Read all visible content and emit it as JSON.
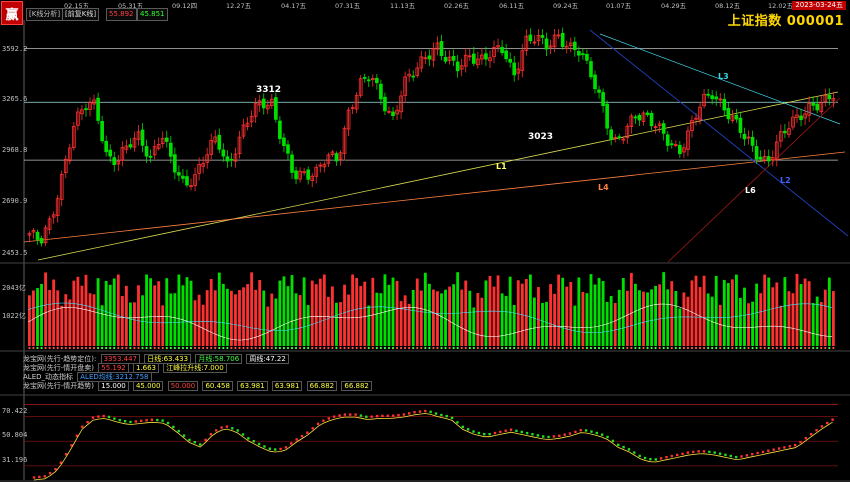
{
  "header": {
    "logo": "赢",
    "mode_label": "[K线分析]",
    "sub_label": "[前复K线]",
    "value_red": "55.892",
    "value_green": "45.851",
    "title": "上证指数  000001",
    "date_badge": "2023-03-24五"
  },
  "colors": {
    "up": "#ff3030",
    "down": "#00e000",
    "grid": "#8a1010",
    "axis": "#606060"
  },
  "chart_data": [
    {
      "type": "candlestick",
      "x_tick_labels": [
        "02.15五",
        "05.31五",
        "09.12四",
        "12.27五",
        "04.17五",
        "07.31五",
        "11.13五",
        "02.26五",
        "06.11五",
        "09.24五",
        "01.07五",
        "04.29五",
        "08.12五",
        "12.02五"
      ],
      "y_ticks": [
        "3592.2",
        "3265.6",
        "2968.8",
        "2690.9",
        "2453.5"
      ],
      "ylim": [
        2400,
        3740
      ],
      "horizontal_levels": [
        3592.2,
        3292,
        2968.8
      ],
      "annotations": [
        "3312",
        "3023",
        "L1",
        "L2",
        "L3",
        "L4",
        "L6"
      ],
      "close_path": [
        2560,
        2500,
        2640,
        2900,
        3150,
        3260,
        3290,
        3000,
        2950,
        3050,
        3120,
        2980,
        3100,
        2950,
        2850,
        2870,
        2980,
        3100,
        2950,
        3070,
        3200,
        3300,
        3300,
        3050,
        2870,
        2900,
        2910,
        2980,
        2960,
        3250,
        3400,
        3430,
        3300,
        3210,
        3400,
        3450,
        3550,
        3620,
        3520,
        3470,
        3560,
        3540,
        3560,
        3580,
        3450,
        3640,
        3640,
        3600,
        3680,
        3600,
        3560,
        3450,
        3300,
        3050,
        3100,
        3230,
        3230,
        3150,
        3060,
        3020,
        3160,
        3280,
        3330,
        3280,
        3200,
        3080,
        3000,
        2970,
        3080,
        3150,
        3220,
        3290,
        3280,
        3320
      ]
    },
    {
      "type": "bar",
      "name": "volume",
      "y_ticks": [
        "2043亿",
        "1022亿"
      ]
    },
    {
      "type": "line",
      "name": "oscillator",
      "y_ticks": [
        "70.422",
        "50.804",
        "31.196"
      ],
      "ylim": [
        20,
        82
      ],
      "series_path": [
        22,
        23,
        30,
        45,
        62,
        70,
        71,
        68,
        66,
        67,
        68,
        67,
        60,
        52,
        48,
        58,
        63,
        60,
        53,
        48,
        44,
        45,
        52,
        58,
        66,
        70,
        72,
        72,
        70,
        71,
        71,
        72,
        74,
        75,
        72,
        70,
        62,
        58,
        56,
        58,
        60,
        58,
        56,
        54,
        55,
        57,
        60,
        58,
        55,
        48,
        44,
        38,
        36,
        38,
        40,
        42,
        43,
        42,
        40,
        38,
        40,
        42,
        44,
        46,
        48,
        55,
        62,
        68
      ]
    }
  ],
  "indicators": [
    {
      "name": "龙宝网(先行-趋势定位):",
      "vals": [
        "3353.447",
        "日线:63.433",
        "月线:58.706",
        "周线:47.22"
      ]
    },
    {
      "name": "龙宝网(先行-情开盘卖)",
      "vals": [
        "55.192",
        "1.663",
        "江峰拉升线:7.000"
      ]
    },
    {
      "name": "ALED_动态指标",
      "vals": [
        "ALED均线:3212.758"
      ]
    },
    {
      "name": "龙宝网(先行-情开趋势)",
      "vals": [
        "15.000",
        "45.000",
        "50.000",
        "60.458",
        "63.981",
        "63.981",
        "66.882",
        "66.882"
      ]
    }
  ]
}
